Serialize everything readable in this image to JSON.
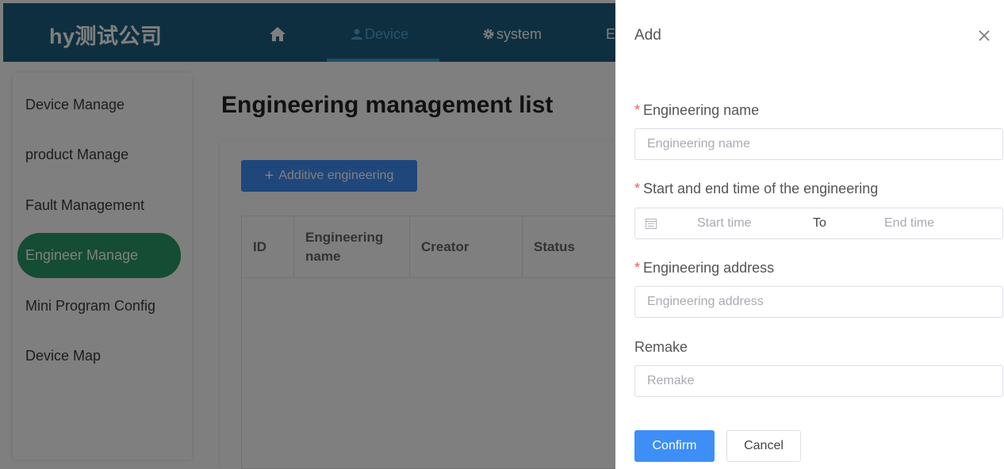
{
  "header": {
    "brand": "hy测试公司",
    "nav": [
      {
        "icon": "home-icon",
        "label": ""
      },
      {
        "icon": "user-icon",
        "label": "Device",
        "active": true
      },
      {
        "icon": "gear-icon",
        "label": "system"
      },
      {
        "icon": "",
        "label": "E"
      }
    ]
  },
  "sidebar": {
    "items": [
      {
        "label": "Device Manage"
      },
      {
        "label": "product Manage"
      },
      {
        "label": "Fault Management"
      },
      {
        "label": "Engineer Manage",
        "active": true
      },
      {
        "label": "Mini Program Config"
      },
      {
        "label": "Device Map"
      }
    ]
  },
  "main": {
    "title": "Engineering management list",
    "add_button": {
      "label": "Additive engineering",
      "icon": "plus-icon"
    },
    "table": {
      "columns": [
        "ID",
        "Engineering name",
        "Creator",
        "Status"
      ],
      "rows": []
    }
  },
  "drawer": {
    "title": "Add",
    "close_icon": "close-icon",
    "fields": {
      "name": {
        "label": "Engineering name",
        "required": true,
        "placeholder": "Engineering name",
        "value": ""
      },
      "time": {
        "label": "Start and end time of the engineering",
        "required": true,
        "start_placeholder": "Start time",
        "separator": "To",
        "end_placeholder": "End time",
        "icon": "calendar-icon"
      },
      "address": {
        "label": "Engineering address",
        "required": true,
        "placeholder": "Engineering address",
        "value": ""
      },
      "remark": {
        "label": "Remake",
        "required": false,
        "placeholder": "Remake",
        "value": ""
      }
    },
    "confirm_label": "Confirm",
    "cancel_label": "Cancel",
    "required_marker": "*"
  },
  "colors": {
    "header_bg": "#1c5f80",
    "accent_blue": "#3e8ef7",
    "sidebar_active": "#2a9968",
    "required_red": "#f25a5a"
  }
}
